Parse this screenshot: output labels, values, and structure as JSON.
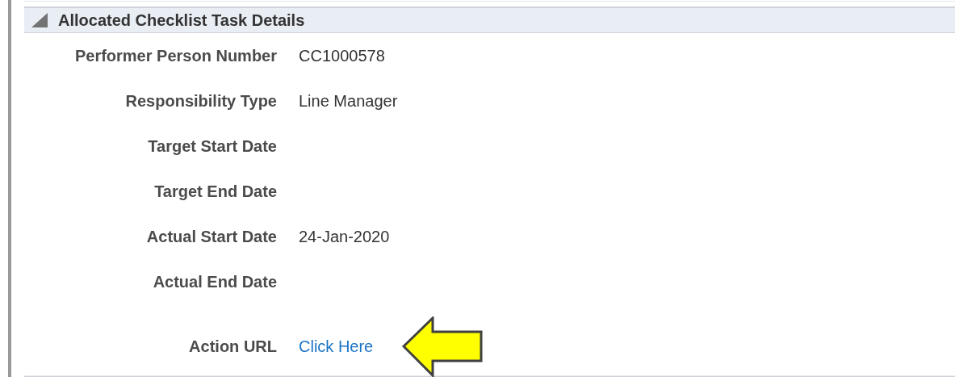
{
  "section": {
    "title": "Allocated Checklist Task Details",
    "expanded": true
  },
  "fields": [
    {
      "label": "Performer Person Number",
      "value": "CC1000578",
      "kind": "text"
    },
    {
      "label": "Responsibility Type",
      "value": "Line Manager",
      "kind": "text"
    },
    {
      "label": "Target Start Date"
    },
    {
      "label": "Target End Date"
    },
    {
      "label": "Actual Start Date",
      "value": "24-Jan-2020",
      "kind": "text"
    },
    {
      "label": "Actual End Date"
    },
    {
      "label": "Action URL",
      "value": "Click Here",
      "kind": "link"
    }
  ]
}
